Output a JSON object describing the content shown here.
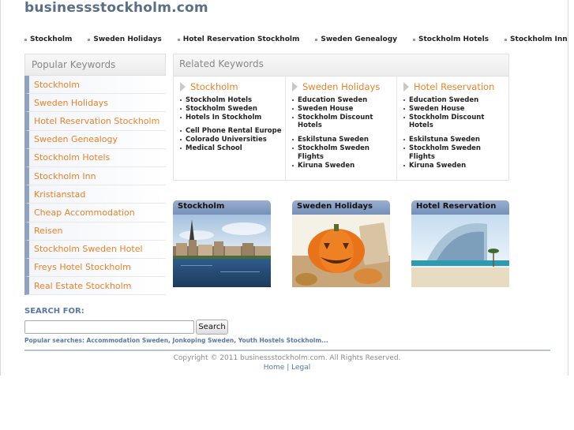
{
  "site": {
    "title": "businessstockholm.com"
  },
  "topnav": [
    "Stockholm",
    "Sweden Holidays",
    "Hotel Reservation Stockholm",
    "Sweden Genealogy",
    "Stockholm Hotels",
    "Stockholm Inn"
  ],
  "sidebar": {
    "heading": "Popular Keywords",
    "items": [
      "Stockholm",
      "Sweden Holidays",
      "Hotel Reservation Stockholm",
      "Sweden Genealogy",
      "Stockholm Hotels",
      "Stockholm Inn",
      "Kristianstad",
      "Cheap Accommodation",
      "Reisen",
      "Stockholm Sweden Hotel",
      "Freys Hotel Stockholm",
      "Real Estate Stockholm"
    ]
  },
  "related": {
    "heading": "Related Keywords",
    "columns": [
      {
        "title": "Stockholm",
        "group1": [
          "Stockholm Hotels",
          "Stockholm Sweden",
          "Hotels In Stockholm"
        ],
        "group2": [
          "Cell Phone Rental Europe",
          "Colorado Universities",
          "Medical School"
        ]
      },
      {
        "title": "Sweden Holidays",
        "group1": [
          "Education Sweden",
          "Sweden House",
          "Stockholm Discount Hotels"
        ],
        "group2": [
          "Eskilstuna Sweden",
          "Stockholm Sweden Flights",
          "Kiruna Sweden"
        ]
      },
      {
        "title": "Hotel Reservation",
        "group1": [
          "Education Sweden",
          "Sweden House",
          "Stockholm Discount Hotels"
        ],
        "group2": [
          "Eskilstuna Sweden",
          "Stockholm Sweden Flights",
          "Kiruna Sweden"
        ]
      }
    ]
  },
  "tiles": [
    "Stockholm",
    "Sweden Holidays",
    "Hotel Reservation"
  ],
  "search": {
    "label": "SEARCH FOR:",
    "value": "",
    "button": "Search",
    "popular": "Popular searches: Accommodation Sweden, Jonkoping Sweden, Youth Hostels Stockholm..."
  },
  "footer": {
    "copyright": "Copyright © 2011 businessstockholm.com. All Rights Reserved.",
    "links": "Home | Legal"
  },
  "colors": {
    "accent": "#e8822a",
    "link": "#5a79a6",
    "title": "#5a6f86"
  }
}
